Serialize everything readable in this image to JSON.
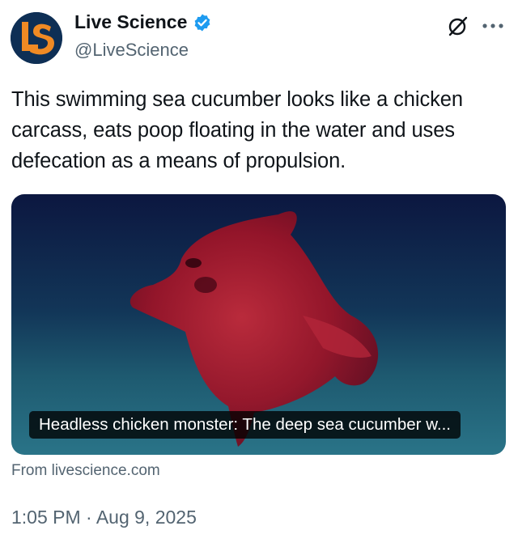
{
  "author": {
    "name": "Live Science",
    "handle": "@LiveScience",
    "avatar_text": "LS",
    "verified": true
  },
  "header_icons": [
    "grok-icon",
    "more-options-icon"
  ],
  "tweet": {
    "text": "This swimming sea cucumber looks like a chicken carcass, eats poop floating in the water and uses defecation as a means of propulsion."
  },
  "card": {
    "title": "Headless chicken monster: The deep sea cucumber w...",
    "source": "From livescience.com"
  },
  "timestamp": "1:05 PM · Aug 9, 2025",
  "colors": {
    "text_primary": "#0f1419",
    "text_secondary": "#536471",
    "verified_blue": "#1d9bf0",
    "avatar_navy": "#0e2f55",
    "avatar_orange": "#f08a24"
  }
}
